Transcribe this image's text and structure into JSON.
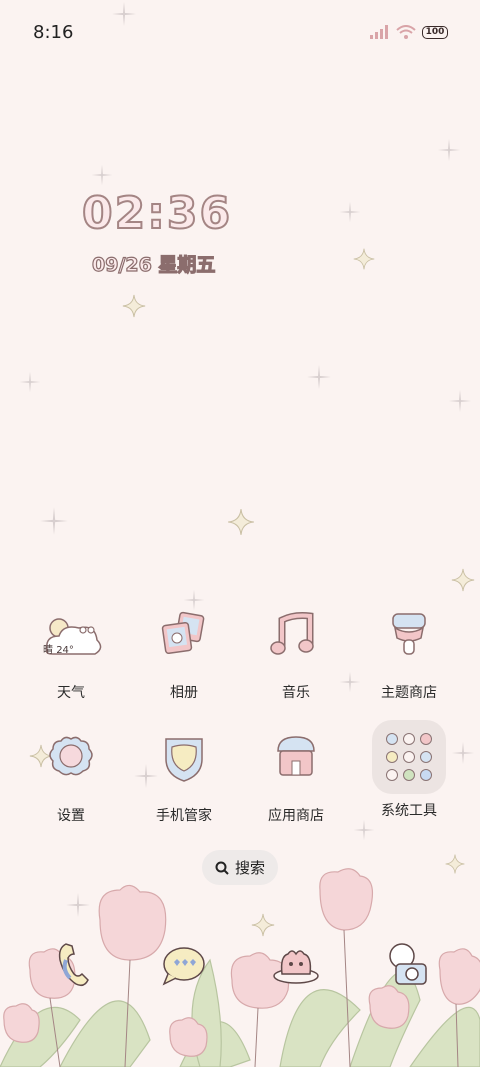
{
  "status_bar": {
    "time": "8:16",
    "battery": "100",
    "icons": [
      "signal-icon",
      "wifi-icon",
      "battery-icon"
    ]
  },
  "clock_widget": {
    "time": "02:36",
    "date": "09/26  星期五"
  },
  "apps": [
    {
      "label": "天气",
      "icon": "weather-icon",
      "temp": "24°",
      "temp_prefix": "晴"
    },
    {
      "label": "相册",
      "icon": "gallery-icon"
    },
    {
      "label": "音乐",
      "icon": "music-icon"
    },
    {
      "label": "主题商店",
      "icon": "theme-store-icon"
    },
    {
      "label": "设置",
      "icon": "settings-icon"
    },
    {
      "label": "手机管家",
      "icon": "phone-manager-icon"
    },
    {
      "label": "应用商店",
      "icon": "app-store-icon"
    },
    {
      "label": "系统工具",
      "icon": "system-tools-folder"
    }
  ],
  "search": {
    "label": "搜索"
  },
  "dock": [
    "phone-icon",
    "messages-icon",
    "browser-icon",
    "camera-icon"
  ],
  "colors": {
    "background": "#fbf3f1",
    "accent_pink": "#f2c6c8",
    "outline": "#8b6d6d",
    "leaf_green": "#cfd9b3"
  }
}
